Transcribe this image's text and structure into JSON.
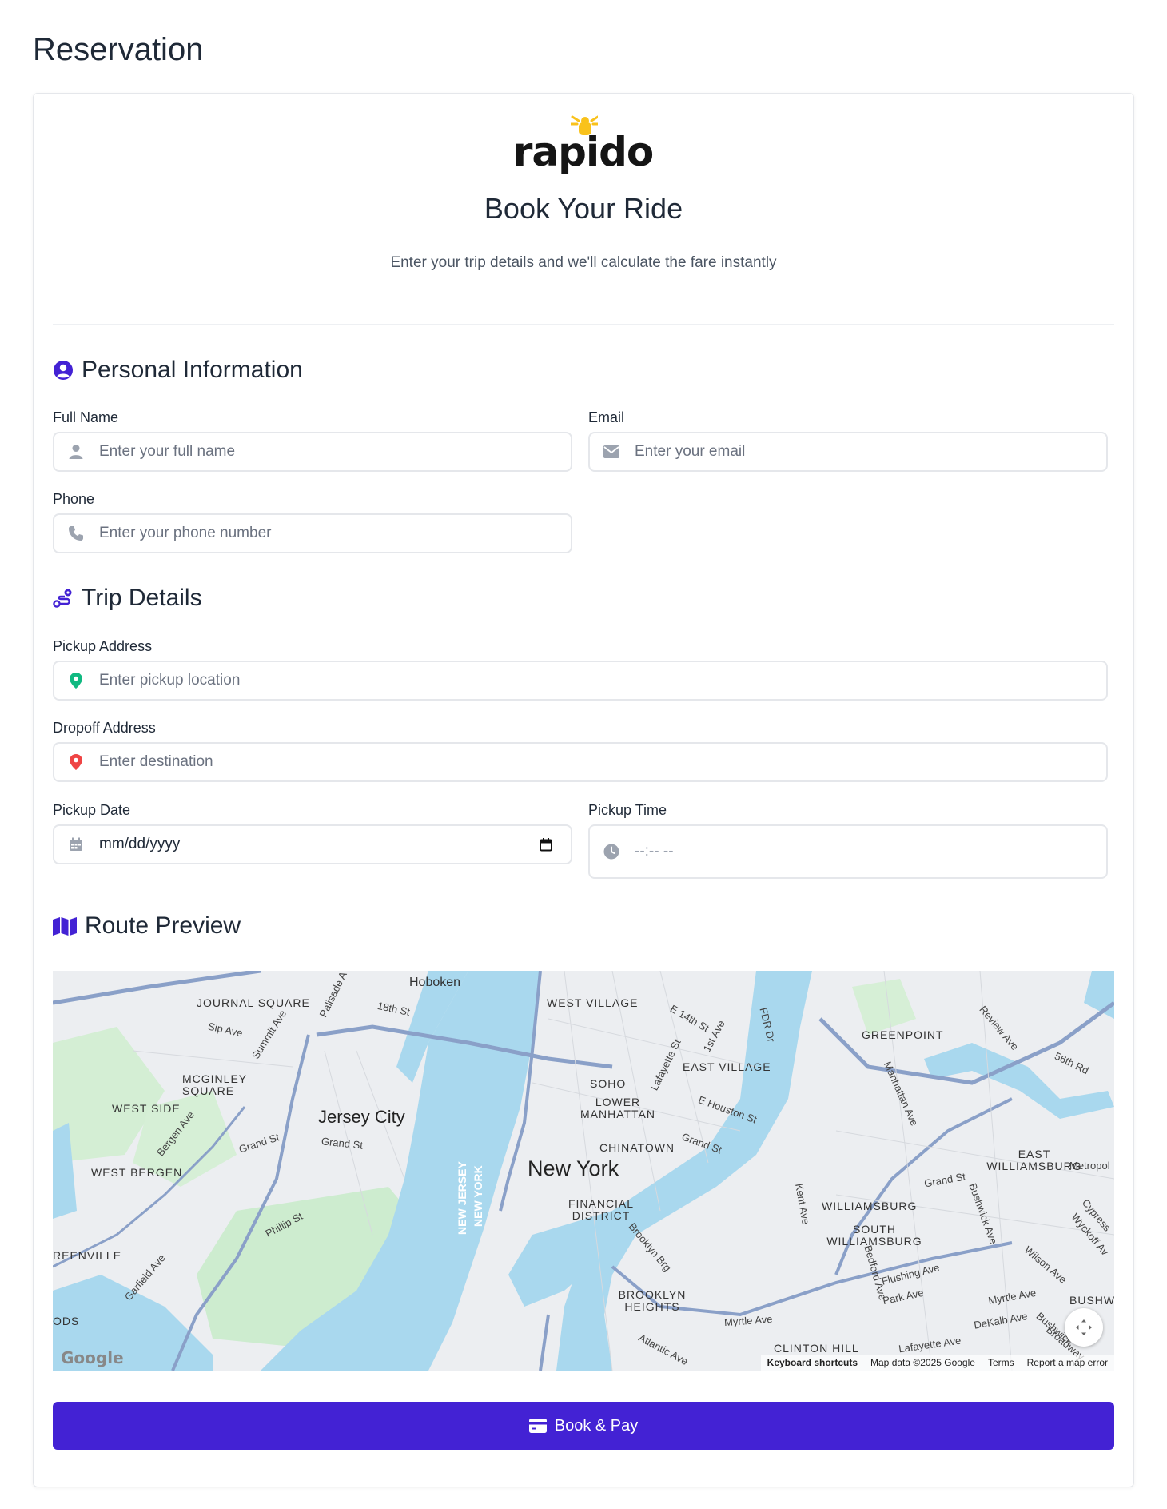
{
  "page": {
    "title": "Reservation"
  },
  "brand": {
    "logo_text": "rapido",
    "accent": "#4322d4",
    "logo_yellow": "#f9c21b"
  },
  "hero": {
    "title": "Book Your Ride",
    "subtitle": "Enter your trip details and we'll calculate the fare instantly"
  },
  "personal": {
    "title": "Personal Information",
    "icon": "user-circle-icon",
    "full_name": {
      "label": "Full Name",
      "placeholder": "Enter your full name",
      "icon": "user-icon"
    },
    "email": {
      "label": "Email",
      "placeholder": "Enter your email",
      "icon": "envelope-icon"
    },
    "phone": {
      "label": "Phone",
      "placeholder": "Enter your phone number",
      "icon": "phone-icon"
    }
  },
  "trip": {
    "title": "Trip Details",
    "icon": "route-icon",
    "pickup": {
      "label": "Pickup Address",
      "placeholder": "Enter pickup location",
      "icon": "pin-green-icon",
      "icon_color": "#10b981"
    },
    "dropoff": {
      "label": "Dropoff Address",
      "placeholder": "Enter destination",
      "icon": "pin-red-icon",
      "icon_color": "#ef4444"
    },
    "date": {
      "label": "Pickup Date",
      "value": "mm/dd/yyyy",
      "icon": "calendar-icon"
    },
    "time": {
      "label": "Pickup Time",
      "value": "--:-- --",
      "icon": "clock-icon"
    }
  },
  "route": {
    "title": "Route Preview",
    "icon": "map-icon",
    "map": {
      "labels": {
        "hoboken": "Hoboken",
        "journal_square": "JOURNAL SQUARE",
        "west_village": "WEST VILLAGE",
        "greenpoint": "GREENPOINT",
        "mcginley": "MCGINLEY SQUARE",
        "east_village": "EAST VILLAGE",
        "soho": "SOHO",
        "lower_manhattan": "LOWER MANHATTAN",
        "west_side": "WEST SIDE",
        "jersey_city": "Jersey City",
        "chinatown": "CHINATOWN",
        "west_bergen": "WEST BERGEN",
        "new_york": "New York",
        "east_williamsburg": "EAST WILLIAMSBURG",
        "financial_district": "FINANCIAL DISTRICT",
        "williamsburg": "WILLIAMSBURG",
        "south_williamsburg": "SOUTH WILLIAMSBURG",
        "greenville": "REENVILLE",
        "brooklyn_heights": "BROOKLYN HEIGHTS",
        "clinton_hill": "CLINTON HILL",
        "bushwick": "BUSHWI",
        "ods": "ODS",
        "nj": "NEW JERSEY",
        "ny": "NEW YORK"
      },
      "streets": [
        "Sip Ave",
        "Summit Ave",
        "18th St",
        "E 14th St",
        "1st Ave",
        "FDR Dr",
        "Review Ave",
        "56th Rd",
        "Manhattan Ave",
        "Lafayette St",
        "E Houston St",
        "Grand St",
        "Bergen Ave",
        "Grand St",
        "Grand St",
        "Grand St",
        "Metropol",
        "Bushwick Ave",
        "Kent Ave",
        "Phillip St",
        "Garfield Ave",
        "Brooklyn Brg",
        "Bedford Ave",
        "Flushing Ave",
        "Park Ave",
        "Myrtle Ave",
        "Wilson Ave",
        "Wyckoff Av",
        "Cypress",
        "Myrtle Ave",
        "DeKalb Ave",
        "Bushwick",
        "Broadway",
        "Lafayette Ave",
        "Atlantic Ave",
        "Palisade A"
      ],
      "google": "Google",
      "footer": {
        "shortcuts": "Keyboard shortcuts",
        "mapdata": "Map data ©2025 Google",
        "terms": "Terms",
        "report": "Report a map error"
      }
    }
  },
  "actions": {
    "book_pay": "Book & Pay",
    "book_pay_icon": "credit-card-icon"
  }
}
